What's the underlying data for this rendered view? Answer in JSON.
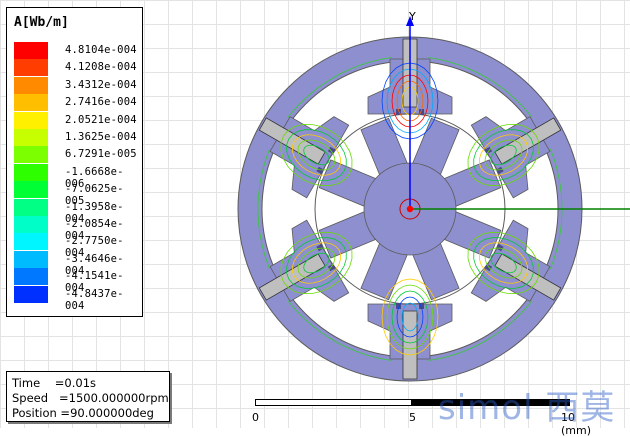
{
  "legend": {
    "title": "A[Wb/m]",
    "entries": [
      {
        "label": "4.8104e-004",
        "color": "#ff0000"
      },
      {
        "label": "4.1208e-004",
        "color": "#ff3d00"
      },
      {
        "label": "3.4312e-004",
        "color": "#ff8a00"
      },
      {
        "label": "2.7416e-004",
        "color": "#ffbf00"
      },
      {
        "label": "2.0521e-004",
        "color": "#fff000"
      },
      {
        "label": "1.3625e-004",
        "color": "#c8ff00"
      },
      {
        "label": "6.7291e-005",
        "color": "#7cff00"
      },
      {
        "label": "-1.6668e-006",
        "color": "#2dff00"
      },
      {
        "label": "-7.0625e-005",
        "color": "#00ff35"
      },
      {
        "label": "-1.3958e-004",
        "color": "#00ff84"
      },
      {
        "label": "-2.0854e-004",
        "color": "#00ffc8"
      },
      {
        "label": "-2.7750e-004",
        "color": "#00f6ff"
      },
      {
        "label": "-3.4646e-004",
        "color": "#00bcff"
      },
      {
        "label": "-4.1541e-004",
        "color": "#0078ff"
      },
      {
        "label": "-4.8437e-004",
        "color": "#0030ff"
      }
    ]
  },
  "info": {
    "time": "Time    =0.01s",
    "speed": "Speed   =1500.000000rpm",
    "position": "Position =90.000000deg"
  },
  "scale": {
    "labels": [
      "0",
      "5",
      "10 (mm)"
    ]
  },
  "axis": {
    "y_label": "Y"
  },
  "watermark": {
    "text": "simol 西莫"
  },
  "colors": {
    "stator": "#8e8fce",
    "rotor": "#8e8fce",
    "coil": "#bfbfbf",
    "outline": "#5b5b5b",
    "x_axis": "#008000",
    "y_axis": "#0000ff",
    "origin": "#ff0000"
  }
}
